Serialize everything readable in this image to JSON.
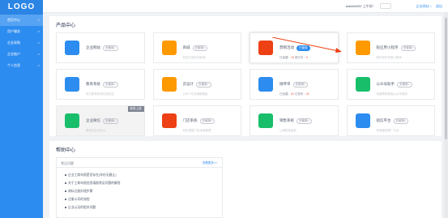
{
  "sidebar": {
    "logo": "LOGO",
    "items": [
      {
        "label": "首页中心",
        "active": true
      },
      {
        "label": "用户服务",
        "active": false
      },
      {
        "label": "企业采购",
        "active": false
      },
      {
        "label": "企业账户",
        "active": false
      },
      {
        "label": "个人信息",
        "active": false
      }
    ]
  },
  "topbar": {
    "user": "alalimiti987 上午好!",
    "home": "企业网站 >",
    "logout": "退出"
  },
  "products": {
    "title": "产品中心",
    "cards": [
      {
        "name": "企业网站",
        "badge": "去使用>",
        "desc": "",
        "color": "#2d8cf0"
      },
      {
        "name": "商城",
        "badge": "去使用>",
        "desc": "轻松打造在线商城",
        "color": "#ff9900"
      },
      {
        "name": "营销活动",
        "badge": "已使用",
        "stat_prefix": "已创建：",
        "stat_num1": "10",
        "stat_mid": "  进行中：",
        "stat_num2": "0",
        "color": "#ed4014"
      },
      {
        "name": "轻应用小程序",
        "badge": "去使用>",
        "desc": "制作你的专属小程序",
        "color": "#ff9900"
      },
      {
        "name": "教育系统",
        "badge": "去使用>",
        "desc": "助力教育机构在线招生",
        "color": "#2d8cf0"
      },
      {
        "name": "云设计",
        "badge": "去使用>",
        "desc": "1000+专业海报模板",
        "color": "#ff9900"
      },
      {
        "name": "微传单",
        "badge": "去使用>",
        "stat_prefix": "已创建：",
        "stat_num1": "21",
        "stat_mid": "  已发布：",
        "stat_num2": "21",
        "color": "#2d8cf0"
      },
      {
        "name": "公众号助手",
        "badge": "去使用>",
        "desc": "快速帮助提高公众号吸粉",
        "color": "#19be6b"
      },
      {
        "name": "企业微信",
        "badge": "去使用>",
        "desc": "移动化企业办公",
        "ribbon": "即将上线",
        "dim": true,
        "color": "#19be6b"
      },
      {
        "name": "门店系统",
        "badge": "去使用>",
        "desc": "轻松搭建门店经营管理",
        "color": "#ed4014"
      },
      {
        "name": "销售系统",
        "badge": "去使用>",
        "desc": "让销售更高效",
        "color": "#19be6b"
      },
      {
        "name": "短信平台",
        "badge": "去使用>",
        "desc": "快速营销推广平台",
        "color": "#2d8cf0"
      }
    ]
  },
  "help": {
    "title": "帮助中心",
    "box_title": "常见问题",
    "more": "查看更多>>",
    "items": [
      "企业工商年报是否存在(年份无截止)",
      "关于工商年报信息填报常见问题的解答",
      "商标注册办理步骤",
      "注册公司的流程",
      "企业认证的相关问题"
    ]
  }
}
